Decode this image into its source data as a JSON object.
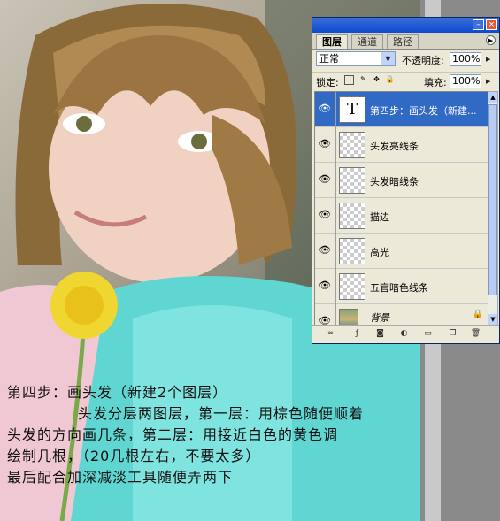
{
  "caption": {
    "line1": "第四步：画头发（新建2个图层）",
    "line2": "头发分层两图层，第一层：用棕色随便顺着",
    "line3": "头发的方向画几条，第二层：用接近白色的黄色调",
    "line4": "绘制几根，（20几根左右，不要太多）",
    "line5": "最后配合加深减淡工具随便弄两下"
  },
  "palette": {
    "tabs": [
      "图层",
      "通道",
      "路径"
    ],
    "active_tab": "图层",
    "blend_mode": "正常",
    "opacity_label": "不透明度:",
    "opacity_value": "100%",
    "lock_label": "锁定:",
    "fill_label": "填充:",
    "fill_value": "100%",
    "layers": [
      {
        "name": "第四步：画头发（新建...",
        "type": "text",
        "thumb": "T",
        "selected": true
      },
      {
        "name": "头发亮线条",
        "type": "normal",
        "selected": false
      },
      {
        "name": "头发暗线条",
        "type": "normal",
        "selected": false
      },
      {
        "name": "描边",
        "type": "normal",
        "selected": false
      },
      {
        "name": "高光",
        "type": "normal",
        "selected": false
      },
      {
        "name": "五官暗色线条",
        "type": "normal",
        "selected": false
      },
      {
        "name": "背景",
        "type": "background",
        "selected": false
      }
    ]
  },
  "colors": {
    "titlebar": "#0a4bd0",
    "selected_layer": "#316ac5",
    "panel_bg": "#ece9d8"
  },
  "icons": [
    "eye-icon",
    "lock-icon",
    "link-icon",
    "layer-style-icon",
    "mask-icon",
    "adjustment-icon",
    "folder-icon",
    "new-layer-icon",
    "trash-icon",
    "minimize-icon",
    "close-icon",
    "palette-menu-icon"
  ]
}
